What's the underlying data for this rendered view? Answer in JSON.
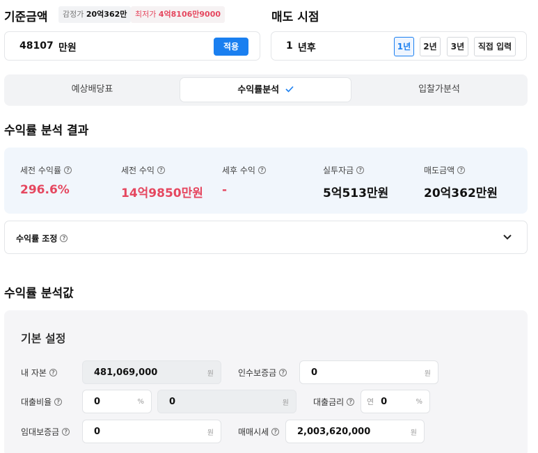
{
  "base": {
    "title": "기준금액",
    "appraisal_label": "감정가",
    "appraisal_value": "20억362만",
    "min_label": "최저가",
    "min_value": "4억8106만9000",
    "amount_value": "48107",
    "amount_unit": "만원",
    "apply_label": "적용"
  },
  "sell": {
    "title": "매도 시점",
    "years_value": "1",
    "years_unit": "년후",
    "options": [
      "1년",
      "2년",
      "3년",
      "직접 입력"
    ],
    "selected": "1년"
  },
  "tabs": [
    {
      "label": "예상배당표",
      "active": false
    },
    {
      "label": "수익률분석",
      "active": true
    },
    {
      "label": "입찰가분석",
      "active": false
    }
  ],
  "result": {
    "title": "수익률 분석 결과",
    "metrics": [
      {
        "label": "세전 수익률",
        "value": "296.6%",
        "color": "#e5475f"
      },
      {
        "label": "세전 수익",
        "value": "14억9850만원",
        "color": "#e5475f"
      },
      {
        "label": "세후 수익",
        "value": "-",
        "color": "#e5475f"
      },
      {
        "label": "실투자금",
        "value": "5억513만원",
        "color": "#111111"
      },
      {
        "label": "매도금액",
        "value": "20억362만원",
        "color": "#111111"
      }
    ]
  },
  "adjust": {
    "label": "수익률 조정"
  },
  "analysis": {
    "title": "수익률 분석값",
    "settings_title": "기본 설정",
    "equity_label": "내 자본",
    "equity_value": "481,069,000",
    "equity_unit": "원",
    "deposit_label": "인수보증금",
    "deposit_value": "0",
    "deposit_unit": "원",
    "loan_ratio_label": "대출비율",
    "loan_ratio_value": "0",
    "loan_ratio_unit": "%",
    "loan_amount_value": "0",
    "loan_amount_unit": "원",
    "interest_label": "대출금리",
    "interest_prefix": "연",
    "interest_value": "0",
    "interest_unit": "%",
    "lease_label": "임대보증금",
    "lease_value": "0",
    "lease_unit": "원",
    "market_label": "매매시세",
    "market_value": "2,003,620,000",
    "market_unit": "원"
  }
}
